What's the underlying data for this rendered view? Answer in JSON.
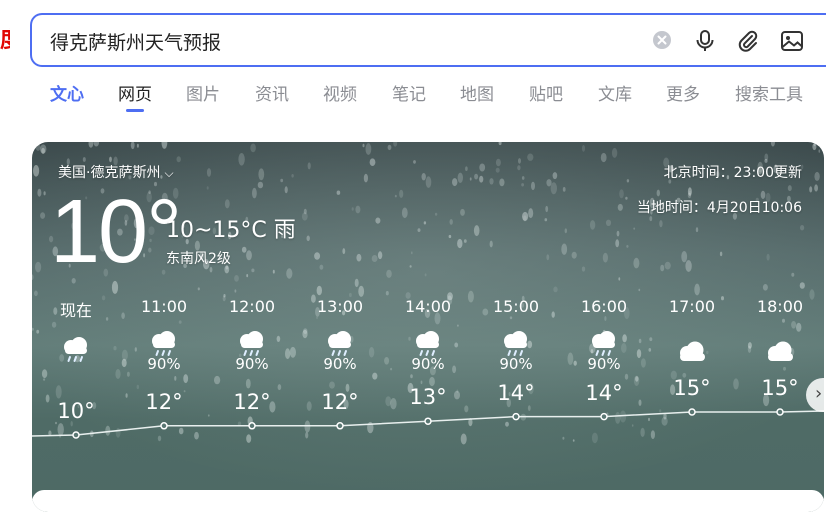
{
  "search": {
    "query": "得克萨斯州天气预报",
    "logo_fragment": "度"
  },
  "tabs": [
    {
      "label": "文心"
    },
    {
      "label": "网页"
    },
    {
      "label": "图片"
    },
    {
      "label": "资讯"
    },
    {
      "label": "视频"
    },
    {
      "label": "笔记"
    },
    {
      "label": "地图"
    },
    {
      "label": "贴吧"
    },
    {
      "label": "文库"
    },
    {
      "label": "更多"
    },
    {
      "label": "搜索工具"
    }
  ],
  "weather": {
    "location": "美国·德克萨斯州",
    "beijing_update": "北京时间：23:00更新",
    "local_time": "当地时间：4月20日10:06",
    "current_temp": "10°",
    "range": "10~15°C",
    "condition": "雨",
    "wind": "东南风2级",
    "hourly": [
      {
        "time": "现在",
        "icon": "rain-cloud-icon",
        "precip": "",
        "temp": "10°",
        "temp_value": 10
      },
      {
        "time": "11:00",
        "icon": "rain-cloud-icon",
        "precip": "90%",
        "temp": "12°",
        "temp_value": 12
      },
      {
        "time": "12:00",
        "icon": "rain-cloud-icon",
        "precip": "90%",
        "temp": "12°",
        "temp_value": 12
      },
      {
        "time": "13:00",
        "icon": "rain-cloud-icon",
        "precip": "90%",
        "temp": "12°",
        "temp_value": 12
      },
      {
        "time": "14:00",
        "icon": "rain-cloud-icon",
        "precip": "90%",
        "temp": "13°",
        "temp_value": 13
      },
      {
        "time": "15:00",
        "icon": "rain-cloud-icon",
        "precip": "90%",
        "temp": "14°",
        "temp_value": 14
      },
      {
        "time": "16:00",
        "icon": "rain-cloud-icon",
        "precip": "90%",
        "temp": "14°",
        "temp_value": 14
      },
      {
        "time": "17:00",
        "icon": "cloud-icon",
        "precip": "",
        "temp": "15°",
        "temp_value": 15
      },
      {
        "time": "18:00",
        "icon": "cloud-icon",
        "precip": "",
        "temp": "15°",
        "temp_value": 15
      }
    ]
  },
  "colors": {
    "accent": "#4e6ef2",
    "logo_red": "#e10602",
    "card_teal": "#5a7773"
  }
}
